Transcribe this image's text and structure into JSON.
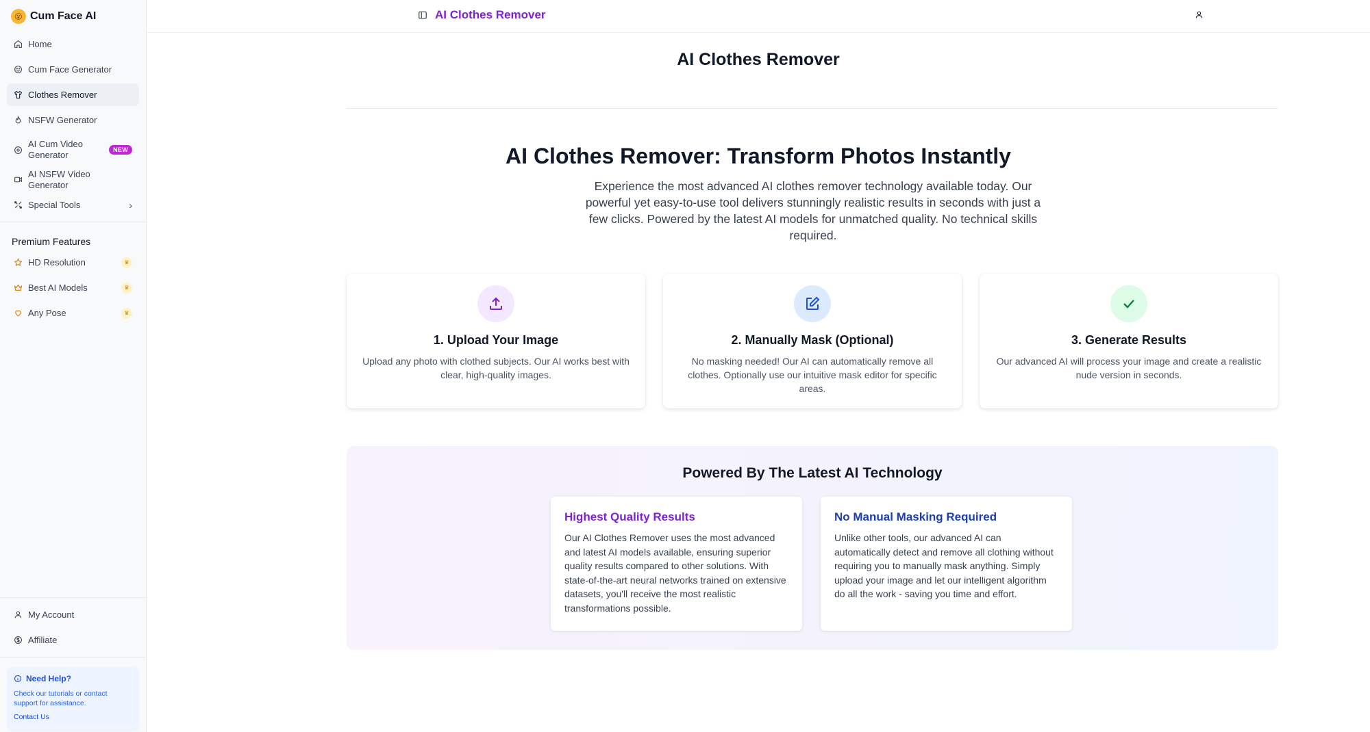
{
  "brand": {
    "name": "Cum Face AI"
  },
  "nav": {
    "items": [
      {
        "label": "Home"
      },
      {
        "label": "Cum Face Generator"
      },
      {
        "label": "Clothes Remover"
      },
      {
        "label": "NSFW Generator"
      },
      {
        "label": "AI Cum Video Generator",
        "badge": "NEW"
      },
      {
        "label": "AI NSFW Video Generator"
      },
      {
        "label": "Special Tools"
      }
    ]
  },
  "premium": {
    "title": "Premium Features",
    "items": [
      {
        "label": "HD Resolution"
      },
      {
        "label": "Best AI Models"
      },
      {
        "label": "Any Pose"
      }
    ]
  },
  "account": {
    "items": [
      {
        "label": "My Account"
      },
      {
        "label": "Affiliate"
      }
    ]
  },
  "help": {
    "title": "Need Help?",
    "text": "Check our tutorials or contact support for assistance.",
    "link": "Contact Us"
  },
  "topbar": {
    "title": "AI Clothes Remover"
  },
  "page": {
    "title": "AI Clothes Remover"
  },
  "hero": {
    "heading": "AI Clothes Remover: Transform Photos Instantly",
    "text": "Experience the most advanced AI clothes remover technology available today. Our powerful yet easy-to-use tool delivers stunningly realistic results in seconds with just a few clicks. Powered by the latest AI models for unmatched quality. No technical skills required."
  },
  "steps": [
    {
      "title": "1. Upload Your Image",
      "desc": "Upload any photo with clothed subjects. Our AI works best with clear, high-quality images."
    },
    {
      "title": "2. Manually Mask (Optional)",
      "desc": "No masking needed! Our AI can automatically remove all clothes. Optionally use our intuitive mask editor for specific areas."
    },
    {
      "title": "3. Generate Results",
      "desc": "Our advanced AI will process your image and create a realistic nude version in seconds."
    }
  ],
  "powered": {
    "heading": "Powered By The Latest AI Technology",
    "features": [
      {
        "title": "Highest Quality Results",
        "color": "#7e22ce",
        "text": "Our AI Clothes Remover uses the most advanced and latest AI models available, ensuring superior quality results compared to other solutions. With state-of-the-art neural networks trained on extensive datasets, you'll receive the most realistic transformations possible."
      },
      {
        "title": "No Manual Masking Required",
        "color": "#1e40af",
        "text": "Unlike other tools, our advanced AI can automatically detect and remove all clothing without requiring you to manually mask anything. Simply upload your image and let our intelligent algorithm do all the work - saving you time and effort."
      }
    ]
  },
  "colors": {
    "accent": "#7e22ce",
    "upload_bg": "#f3e8ff",
    "mask_bg": "#dbeafe",
    "check_bg": "#dcfce7"
  }
}
